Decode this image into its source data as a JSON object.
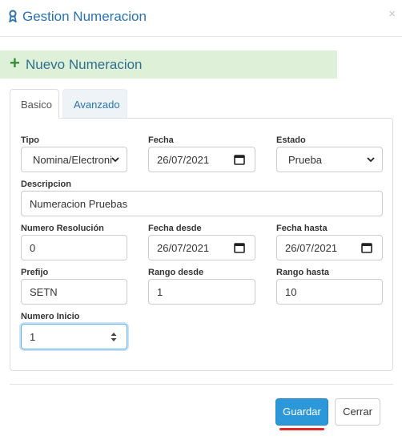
{
  "header": {
    "title": "Gestion Numeracion",
    "close_glyph": "×",
    "icon": "ribbon-award-icon"
  },
  "banner": {
    "plus_glyph": "+",
    "title": "Nuevo Numeracion",
    "background": "#dff0d8"
  },
  "tabs": [
    {
      "label": "Basico",
      "active": true
    },
    {
      "label": "Avanzado",
      "active": false
    }
  ],
  "form": {
    "tipo": {
      "label": "Tipo",
      "value": "Nomina/Electroni"
    },
    "fecha": {
      "label": "Fecha",
      "value": "26/07/2021"
    },
    "estado": {
      "label": "Estado",
      "value": "Prueba"
    },
    "descripcion": {
      "label": "Descripcion",
      "value": "Numeracion Pruebas"
    },
    "numero_resolucion": {
      "label": "Numero Resolución",
      "value": "0"
    },
    "fecha_desde": {
      "label": "Fecha desde",
      "value": "26/07/2021"
    },
    "fecha_hasta": {
      "label": "Fecha hasta",
      "value": "26/07/2021"
    },
    "prefijo": {
      "label": "Prefijo",
      "value": "SETN"
    },
    "rango_desde": {
      "label": "Rango desde",
      "value": "1"
    },
    "rango_hasta": {
      "label": "Rango hasta",
      "value": "10"
    },
    "numero_inicio": {
      "label": "Numero Inicio",
      "value": "1"
    }
  },
  "footer": {
    "save_label": "Guardar",
    "close_label": "Cerrar"
  },
  "colors": {
    "accent": "#2a73b0",
    "primary_button": "#2d98d9",
    "highlight_underline": "#e3262b"
  }
}
